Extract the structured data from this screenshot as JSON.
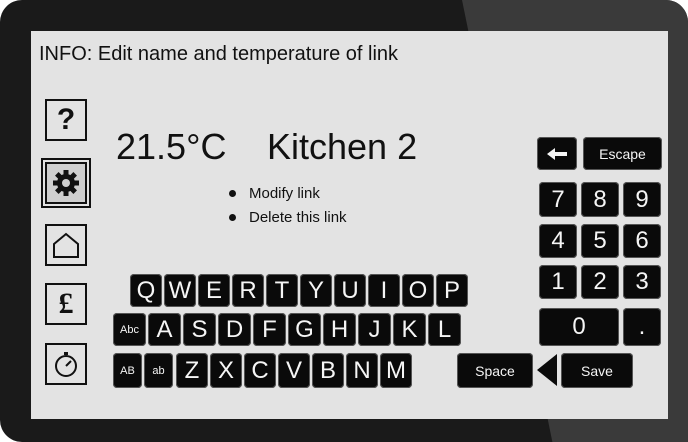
{
  "info": "INFO: Edit name and temperature of link",
  "temperature": "21.5°C",
  "link_name": "Kitchen 2",
  "menu": [
    "Modify link",
    "Delete this link"
  ],
  "sidebar": [
    {
      "name": "help",
      "icon": "question-icon",
      "glyph": "?"
    },
    {
      "name": "settings",
      "icon": "gear-icon",
      "active": true
    },
    {
      "name": "home",
      "icon": "house-icon"
    },
    {
      "name": "cost",
      "icon": "pound-icon",
      "glyph": "£"
    },
    {
      "name": "timer",
      "icon": "stopwatch-icon"
    }
  ],
  "keyboard": {
    "row1": [
      "Q",
      "W",
      "E",
      "R",
      "T",
      "Y",
      "U",
      "I",
      "O",
      "P"
    ],
    "row2": [
      "A",
      "S",
      "D",
      "F",
      "G",
      "H",
      "J",
      "K",
      "L"
    ],
    "row3": [
      "Z",
      "X",
      "C",
      "V",
      "B",
      "N",
      "M"
    ],
    "abc": "Abc",
    "caps": "AB",
    "lower": "ab",
    "space": "Space",
    "save": "Save",
    "escape": "Escape",
    "numpad": [
      "7",
      "8",
      "9",
      "4",
      "5",
      "6",
      "1",
      "2",
      "3"
    ],
    "zero": "0",
    "dot": "."
  }
}
